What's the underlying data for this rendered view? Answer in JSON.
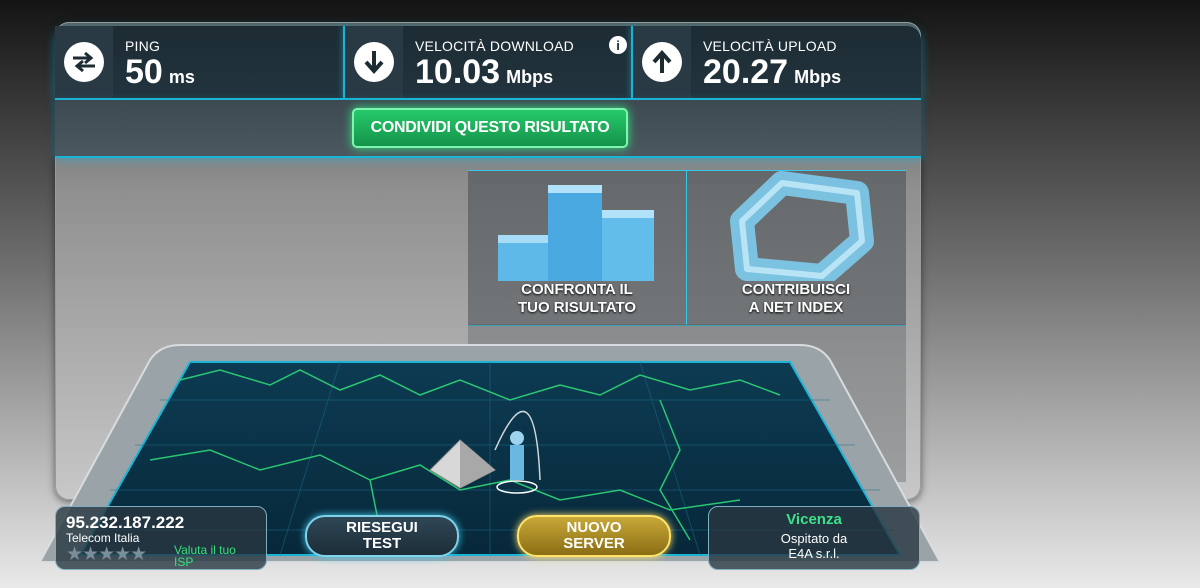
{
  "stats": {
    "ping": {
      "label": "PING",
      "value": "50",
      "unit": "ms",
      "icon": "transfer-arrows-icon"
    },
    "download": {
      "label": "VELOCITÀ DOWNLOAD",
      "value": "10.03",
      "unit": "Mbps",
      "icon": "download-arrow-icon"
    },
    "upload": {
      "label": "VELOCITÀ UPLOAD",
      "value": "20.27",
      "unit": "Mbps",
      "icon": "upload-arrow-icon"
    },
    "info_glyph": "i"
  },
  "share": {
    "label": "CONDIVIDI QUESTO RISULTATO"
  },
  "tiles": {
    "compare": {
      "line1": "CONFRONTA IL",
      "line2": "TUO RISULTATO",
      "icon": "bar-chart-icon"
    },
    "netindex": {
      "line1": "CONTRIBUISCI",
      "line2": "A NET INDEX",
      "icon": "net-index-ring-icon"
    }
  },
  "client": {
    "ip": "95.232.187.222",
    "isp": "Telecom Italia",
    "stars": "★★★★★",
    "rate_line1": "Valuta il tuo",
    "rate_line2": "ISP"
  },
  "buttons": {
    "retest_line1": "RIESEGUI",
    "retest_line2": "TEST",
    "server_line1": "NUOVO",
    "server_line2": "SERVER"
  },
  "server": {
    "city": "Vicenza",
    "host_line1": "Ospitato da",
    "host_line2": "E4A s.r.l."
  },
  "colors": {
    "accent_cyan": "#1bb4d6",
    "share_green": "#26c96b",
    "server_gold": "#c8a838"
  }
}
